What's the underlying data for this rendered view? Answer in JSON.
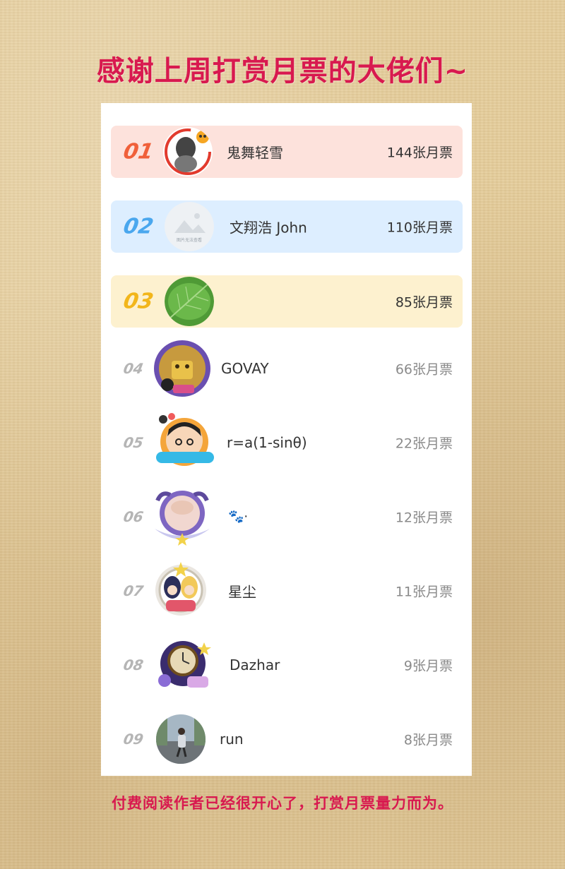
{
  "title": "感谢上周打赏月票的大佬们~",
  "footer": "付费阅读作者已经很开心了，打赏月票量力而为。",
  "avatar_placeholder_text": "图片无法查看",
  "colors": {
    "accent": "#d8194f",
    "rank1": "#f0603a",
    "rank2": "#4aa7ee",
    "rank3": "#f2b61b",
    "rank_other": "#b5b5b5"
  },
  "entries": [
    {
      "rank": "01",
      "name": "鬼舞轻雪",
      "votes": "144张月票"
    },
    {
      "rank": "02",
      "name": "文翔浩 John",
      "votes": "110张月票"
    },
    {
      "rank": "03",
      "name": "",
      "votes": "85张月票"
    },
    {
      "rank": "04",
      "name": "GOVAY",
      "votes": "66张月票"
    },
    {
      "rank": "05",
      "name": "r=a(1-sinθ)",
      "votes": "22张月票"
    },
    {
      "rank": "06",
      "name": "🐾·",
      "votes": "12张月票"
    },
    {
      "rank": "07",
      "name": "星尘",
      "votes": "11张月票"
    },
    {
      "rank": "08",
      "name": "Dazhar",
      "votes": "9张月票"
    },
    {
      "rank": "09",
      "name": "run",
      "votes": "8张月票"
    }
  ]
}
